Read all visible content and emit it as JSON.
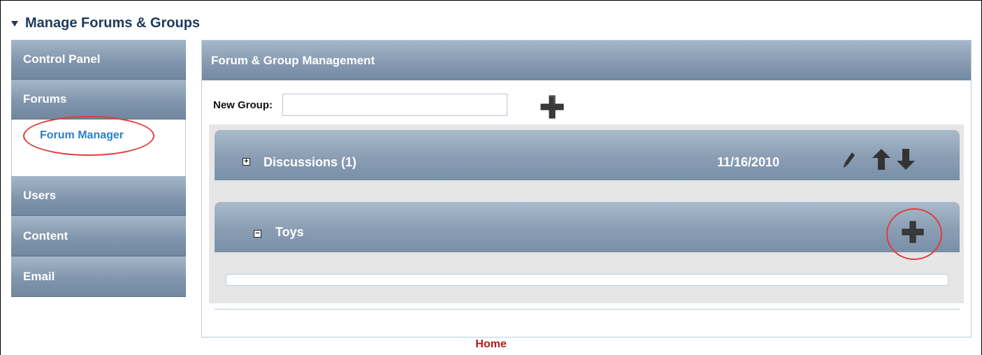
{
  "page": {
    "title": "Manage Forums & Groups"
  },
  "sidebar": {
    "items": [
      {
        "label": "Control Panel"
      },
      {
        "label": "Forums",
        "subitems": [
          {
            "label": "Forum Manager"
          }
        ]
      },
      {
        "label": "Users"
      },
      {
        "label": "Content"
      },
      {
        "label": "Email"
      }
    ]
  },
  "panel": {
    "title": "Forum & Group Management",
    "new_group": {
      "label": "New Group:",
      "value": "",
      "add_icon": "plus-icon"
    },
    "groups": [
      {
        "name": "Discussions  (1)",
        "expander": "expand",
        "date": "11/16/2010",
        "actions": [
          "pencil-icon",
          "arrow-up-icon",
          "arrow-down-icon"
        ]
      },
      {
        "name": "Toys",
        "expander": "collapse",
        "actions": [
          "plus-icon"
        ]
      }
    ]
  },
  "footer": {
    "home_label": "Home"
  },
  "colors": {
    "header_text": "#1c3a5c",
    "link": "#2a7fc8",
    "home_link": "#b11a1a",
    "highlight": "#e23b3b",
    "bar_gradient_mid": "#8598ae"
  }
}
